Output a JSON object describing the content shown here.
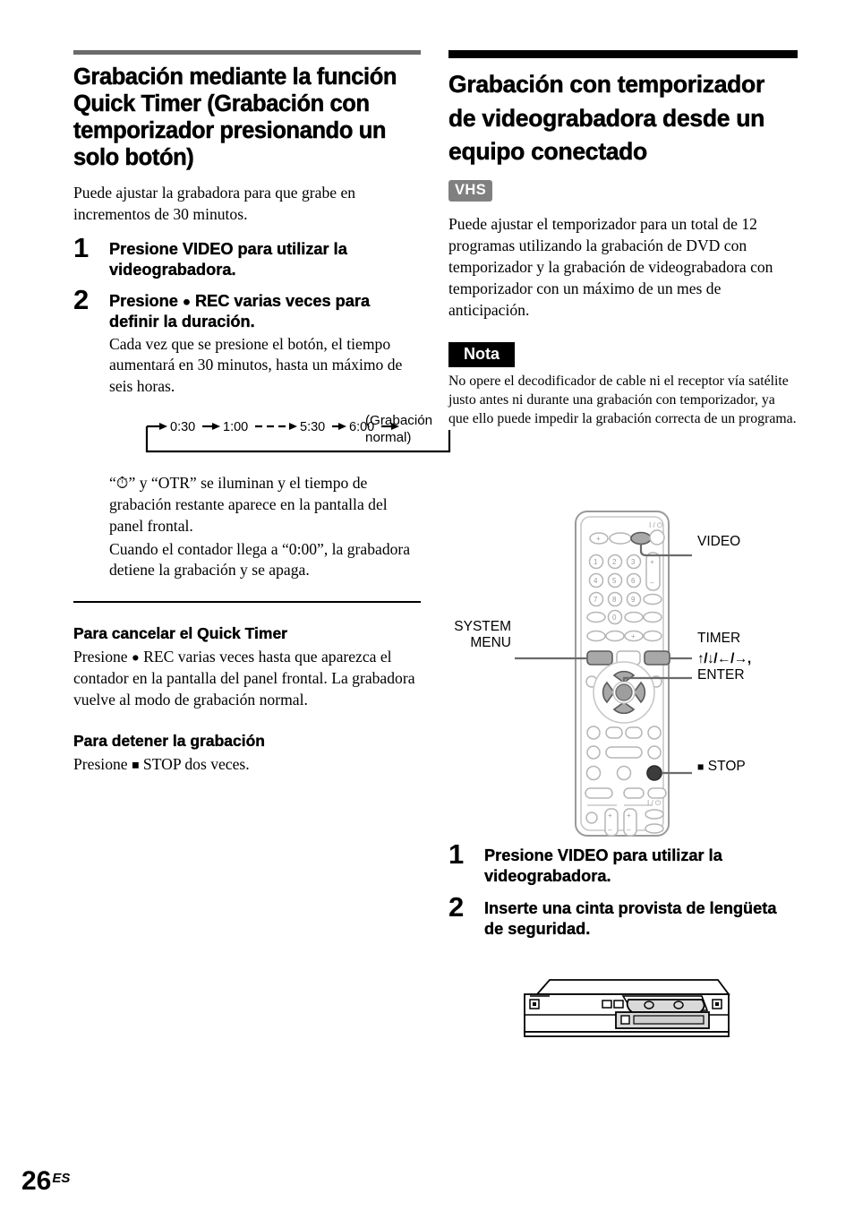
{
  "page": {
    "folio_number": "26",
    "folio_suffix": "ES"
  },
  "left_column": {
    "heading": "Grabación mediante la función Quick Timer (Grabación con temporizador presionando un solo botón)",
    "intro": "Puede ajustar la grabadora para que grabe en incrementos de 30 minutos.",
    "steps": [
      {
        "number": "1",
        "headline": "Presione VIDEO para utilizar la videograbadora.",
        "detail": ""
      },
      {
        "number": "2",
        "headline_before": "Presione ",
        "headline_glyph": "●",
        "headline_after": " REC varias veces para definir la duración.",
        "detail": "Cada vez que se presione el botón, el tiempo aumentará en 30 minutos, hasta un máximo de seis horas."
      }
    ],
    "flow_diagram": {
      "steps": [
        "0:30",
        "1:00",
        "5:30",
        "6:00"
      ],
      "dashed_between": "1:00 → 5:30",
      "end_label": "(Grabación normal)"
    },
    "after_diagram_line1": "“⏱” y “OTR” se iluminan y el tiempo de grabación restante aparece en la pantalla del panel frontal.",
    "after_diagram_line2": "Cuando el contador llega a “0:00”, la grabadora detiene la grabación y se apaga.",
    "subsections": [
      {
        "title": "Para cancelar el Quick Timer",
        "text_before": "Presione ",
        "glyph": "●",
        "text_after": " REC varias veces hasta que aparezca el contador en la pantalla del panel frontal. La grabadora vuelve al modo de grabación normal."
      },
      {
        "title": "Para detener la grabación",
        "text_before": "Presione ",
        "glyph": "■",
        "text_after": " STOP dos veces."
      }
    ]
  },
  "right_column": {
    "heading": "Grabación con temporizador de videograbadora desde un equipo conectado",
    "badge": "VHS",
    "intro": "Puede ajustar el temporizador para un total de 12 programas utilizando la grabación de DVD con temporizador y la grabación de videograbadora con temporizador con un máximo de un mes de anticipación.",
    "note": {
      "label": "Nota",
      "text": "No opere el decodificador de cable ni el receptor vía satélite justo antes ni durante una grabación con temporizador, ya que ello puede impedir la grabación correcta de un programa."
    },
    "remote_callouts": {
      "system_menu_line1": "SYSTEM",
      "system_menu_line2": "MENU",
      "video": "VIDEO",
      "timer": "TIMER",
      "arrows": "↑/↓/←/→,",
      "enter": "ENTER",
      "stop_glyph": "■",
      "stop": "STOP"
    },
    "steps": [
      {
        "number": "1",
        "headline": "Presione VIDEO para utilizar la videograbadora."
      },
      {
        "number": "2",
        "headline": "Inserte una cinta provista de lengüeta de seguridad."
      }
    ]
  },
  "colors": {
    "rule_gray": "#6b6b6b",
    "rule_black": "#000000",
    "badge_vhs_bg": "#808080",
    "badge_nota_bg": "#000000",
    "button_highlight": "#a0a0a0"
  }
}
